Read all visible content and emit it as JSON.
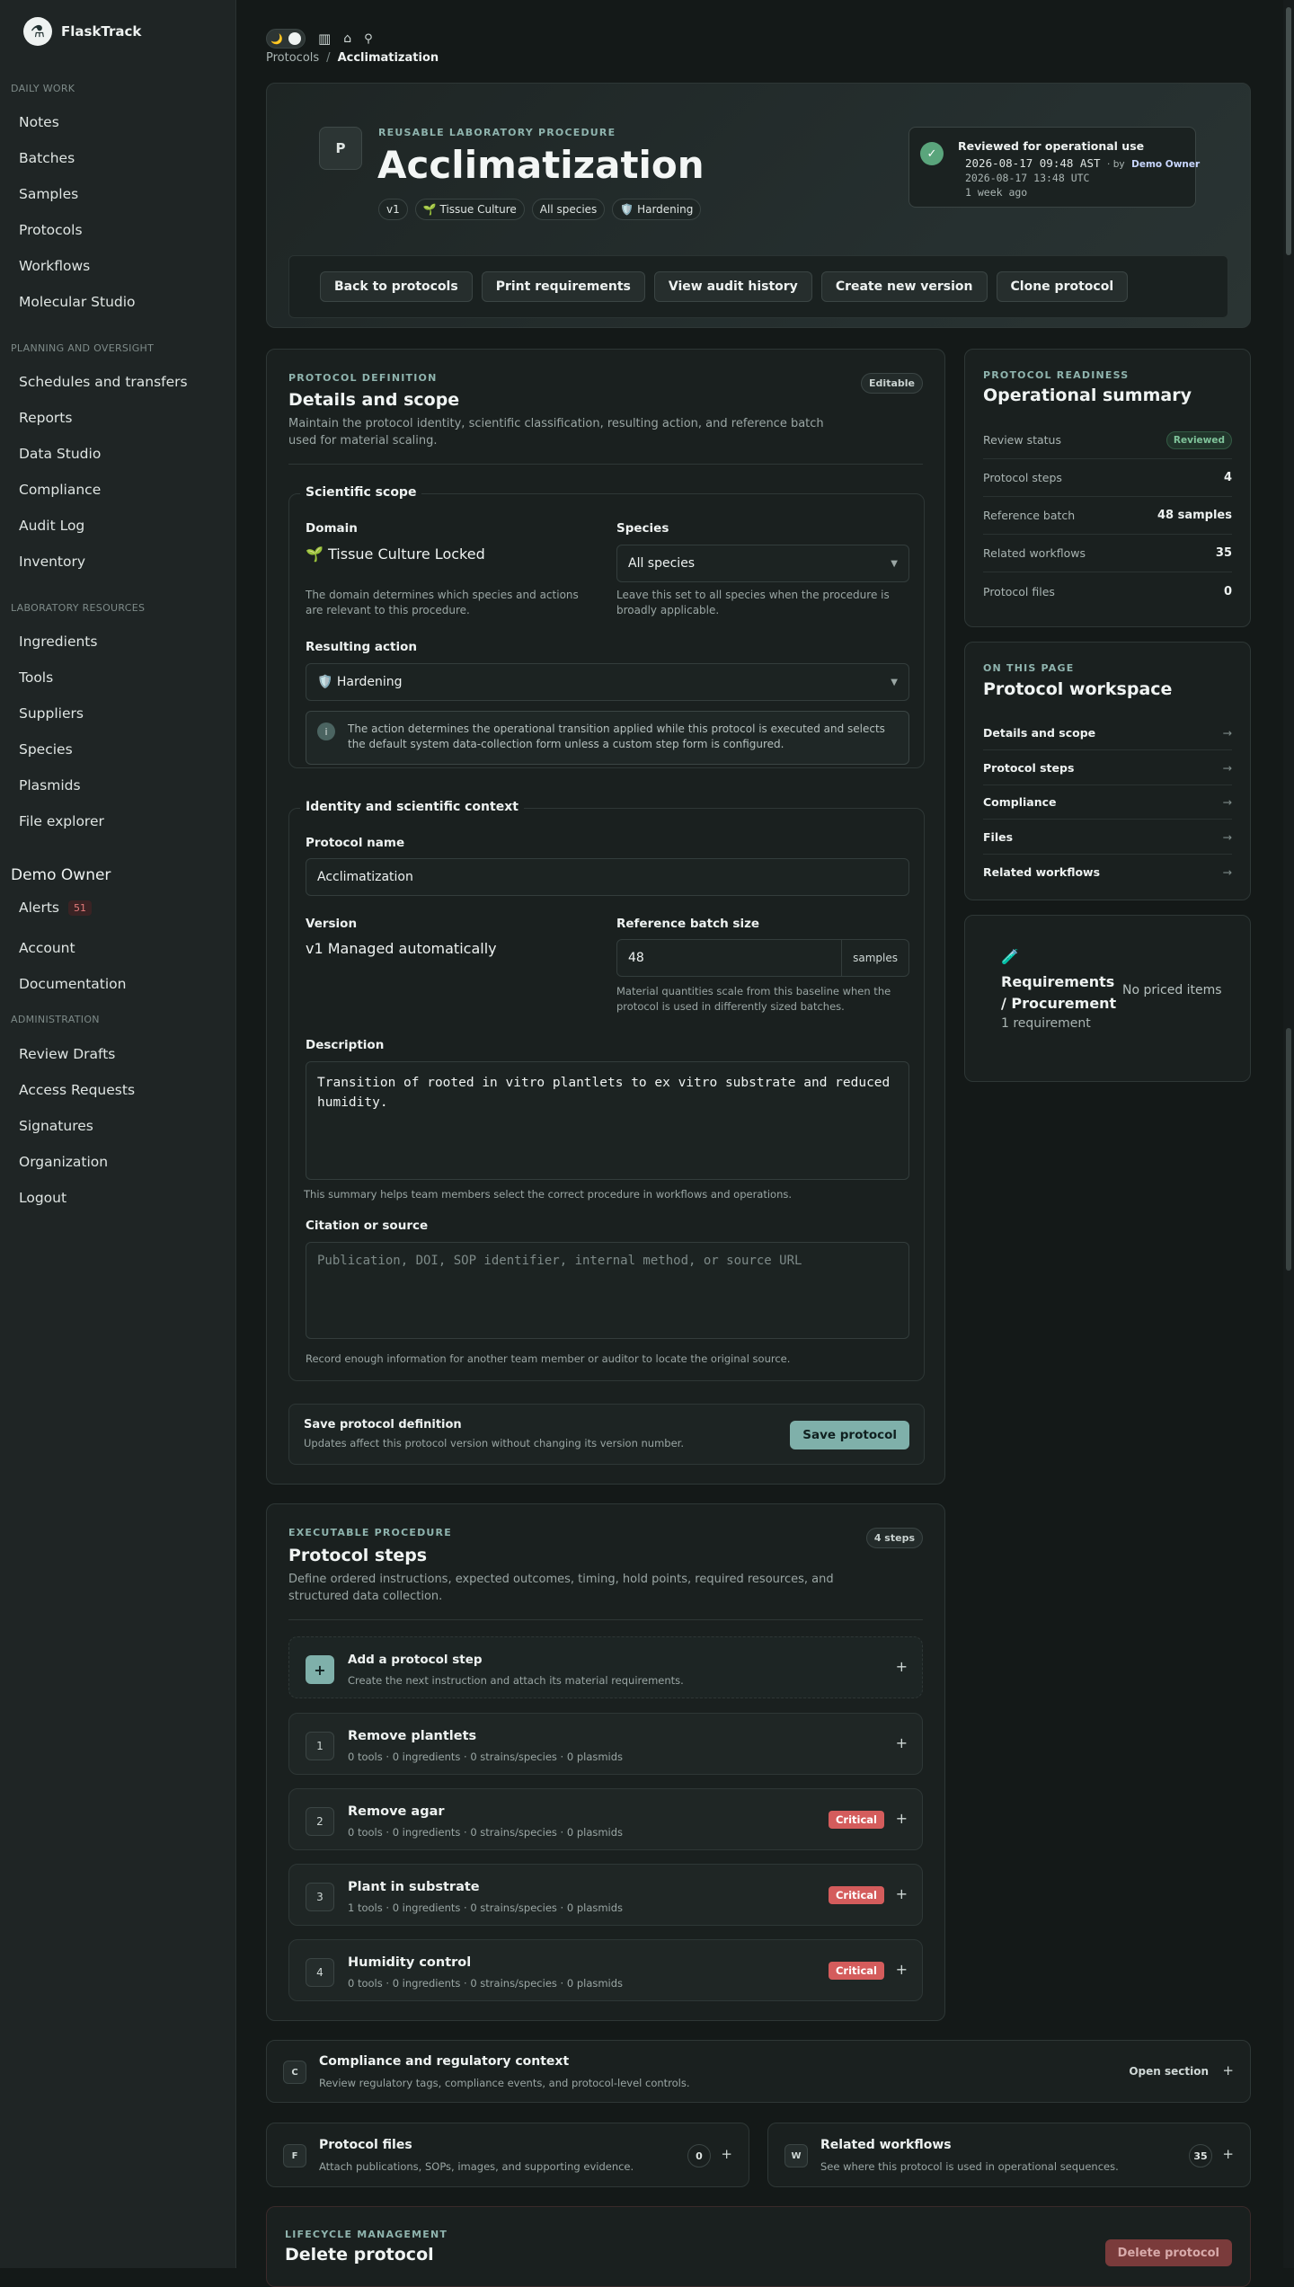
{
  "app": {
    "name": "FlaskTrack"
  },
  "sidebar": {
    "sections": {
      "daily": "DAILY WORK",
      "planning": "PLANNING AND OVERSIGHT",
      "lab": "LABORATORY RESOURCES",
      "admin": "ADMINISTRATION"
    },
    "daily_items": [
      "Notes",
      "Batches",
      "Samples",
      "Protocols",
      "Workflows",
      "Molecular Studio"
    ],
    "planning_items": [
      "Schedules and transfers",
      "Reports",
      "Data Studio",
      "Compliance",
      "Audit Log",
      "Inventory"
    ],
    "lab_items": [
      "Ingredients",
      "Tools",
      "Suppliers",
      "Species",
      "Plasmids",
      "File explorer"
    ],
    "user_name": "Demo Owner",
    "alerts_label": "Alerts",
    "alerts_count": "51",
    "account": "Account",
    "documentation": "Documentation",
    "admin_items": [
      "Review Drafts",
      "Access Requests",
      "Signatures",
      "Organization",
      "Logout"
    ]
  },
  "topbar": {
    "theme_icons": "🌙",
    "breadcrumb_parent": "Protocols",
    "breadcrumb_sep": "/",
    "breadcrumb_current": "Acclimatization"
  },
  "hero": {
    "avatar_letter": "P",
    "eyebrow": "REUSABLE LABORATORY PROCEDURE",
    "title": "Acclimatization",
    "chips": [
      "v1",
      "🌱 Tissue Culture",
      "All species",
      "🛡️ Hardening"
    ],
    "review": {
      "title": "Reviewed for operational use",
      "time_local": "2026-08-17 09:48 AST",
      "by_prefix": "· by",
      "by_name": "Demo Owner",
      "time_utc": "2026-08-17 13:48 UTC",
      "relative": "1 week ago"
    },
    "actions": [
      "Back to protocols",
      "Print requirements",
      "View audit history",
      "Create new version",
      "Clone protocol"
    ]
  },
  "definition": {
    "eyebrow": "PROTOCOL DEFINITION",
    "title": "Details and scope",
    "badge": "Editable",
    "desc": "Maintain the protocol identity, scientific classification, resulting action, and reference batch used for material scaling.",
    "scope_legend": "Scientific scope",
    "domain_label": "Domain",
    "domain_value": "🌱 Tissue Culture Locked",
    "domain_help": "The domain determines which species and actions are relevant to this procedure.",
    "species_label": "Species",
    "species_value": "All species",
    "species_help": "Leave this set to all species when the procedure is broadly applicable.",
    "action_label": "Resulting action",
    "action_value": "🛡️ Hardening",
    "action_info": "The action determines the operational transition applied while this protocol is executed and selects the default system data-collection form unless a custom step form is configured.",
    "identity_legend": "Identity and scientific context",
    "name_label": "Protocol name",
    "name_value": "Acclimatization",
    "version_label": "Version",
    "version_value": "v1 Managed automatically",
    "batch_label": "Reference batch size",
    "batch_value": "48",
    "batch_unit": "samples",
    "batch_help": "Material quantities scale from this baseline when the protocol is used in differently sized batches.",
    "description_label": "Description",
    "description_value": "Transition of rooted in vitro plantlets to ex vitro substrate and reduced humidity.",
    "description_help": "This summary helps team members select the correct procedure in workflows and operations.",
    "citation_label": "Citation or source",
    "citation_placeholder": "Publication, DOI, SOP identifier, internal method, or source URL",
    "citation_help": "Record enough information for another team member or auditor to locate the original source.",
    "save_title": "Save protocol definition",
    "save_desc": "Updates affect this protocol version without changing its version number.",
    "save_button": "Save protocol"
  },
  "steps": {
    "eyebrow": "EXECUTABLE PROCEDURE",
    "title": "Protocol steps",
    "badge": "4 steps",
    "desc": "Define ordered instructions, expected outcomes, timing, hold points, required resources, and structured data collection.",
    "add_title": "Add a protocol step",
    "add_desc": "Create the next instruction and attach its material requirements.",
    "items": [
      {
        "num": "1",
        "title": "Remove plantlets",
        "meta": "0 tools · 0 ingredients · 0 strains/species · 0 plasmids",
        "critical": ""
      },
      {
        "num": "2",
        "title": "Remove agar",
        "meta": "0 tools · 0 ingredients · 0 strains/species · 0 plasmids",
        "critical": "Critical"
      },
      {
        "num": "3",
        "title": "Plant in substrate",
        "meta": "1 tools · 0 ingredients · 0 strains/species · 0 plasmids",
        "critical": "Critical"
      },
      {
        "num": "4",
        "title": "Humidity control",
        "meta": "0 tools · 0 ingredients · 0 strains/species · 0 plasmids",
        "critical": "Critical"
      }
    ]
  },
  "readiness": {
    "eyebrow": "PROTOCOL READINESS",
    "title": "Operational summary",
    "rows": [
      {
        "label": "Review status",
        "value": "Reviewed"
      },
      {
        "label": "Protocol steps",
        "value": "4"
      },
      {
        "label": "Reference batch",
        "value": "48 samples"
      },
      {
        "label": "Related workflows",
        "value": "35"
      },
      {
        "label": "Protocol files",
        "value": "0"
      }
    ]
  },
  "onpage": {
    "eyebrow": "ON THIS PAGE",
    "title": "Protocol workspace",
    "links": [
      "Details and scope",
      "Protocol steps",
      "Compliance",
      "Files",
      "Related workflows"
    ],
    "arrow": "→"
  },
  "requirements": {
    "icon": "🧪",
    "title_line1": "Requirements",
    "title_line2": "/ Procurement",
    "count": "1 requirement",
    "priced": "No priced items"
  },
  "compliance": {
    "letter": "C",
    "title": "Compliance and regulatory context",
    "desc": "Review regulatory tags, compliance events, and protocol-level controls.",
    "open": "Open section"
  },
  "files": {
    "letter": "F",
    "title": "Protocol files",
    "desc": "Attach publications, SOPs, images, and supporting evidence.",
    "count": "0"
  },
  "workflows": {
    "letter": "W",
    "title": "Related workflows",
    "desc": "See where this protocol is used in operational sequences.",
    "count": "35"
  },
  "lifecycle": {
    "eyebrow": "LIFECYCLE MANAGEMENT",
    "title": "Delete protocol",
    "button": "Delete protocol"
  },
  "colors": {
    "accent": "#8fb4ae",
    "primary_button": "#7fb0aa",
    "critical": "#d45c5c",
    "reviewed": "#7fc39a",
    "delete": "#7a3b3b"
  }
}
